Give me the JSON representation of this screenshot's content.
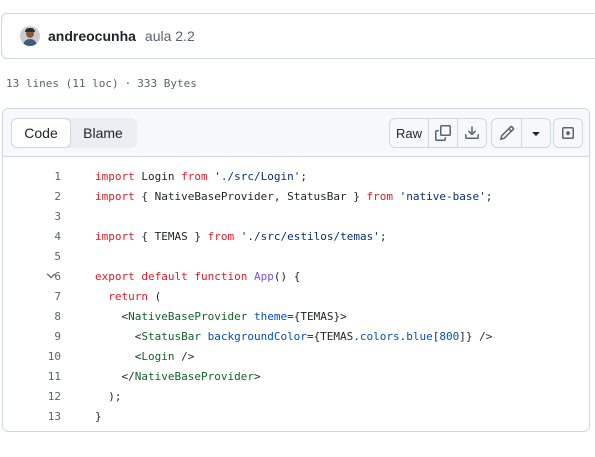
{
  "commit": {
    "author": "andreocunha",
    "message": "aula 2.2"
  },
  "file_info": {
    "lines": "13 lines (11 loc)",
    "separator": "·",
    "size": "333 Bytes"
  },
  "toolbar": {
    "code_label": "Code",
    "blame_label": "Blame",
    "raw_label": "Raw",
    "icons": [
      "copy-icon",
      "download-icon",
      "pencil-icon",
      "triangle-down-icon",
      "symbols-icon"
    ]
  },
  "colors": {
    "keyword": "#cf222e",
    "string": "#0a3069",
    "function": "#8250df",
    "tag": "#116329",
    "attribute": "#0550ae",
    "border": "#d0d7de"
  },
  "code": {
    "line_numbers": [
      "1",
      "2",
      "3",
      "4",
      "5",
      "6",
      "7",
      "8",
      "9",
      "10",
      "11",
      "12",
      "13"
    ],
    "l1": [
      "import",
      " Login ",
      "from",
      " ",
      "'./src/Login'",
      ";"
    ],
    "l2": [
      "import",
      " { NativeBaseProvider, StatusBar } ",
      "from",
      " ",
      "'native-base'",
      ";"
    ],
    "l4": [
      "import",
      " { TEMAS } ",
      "from",
      " ",
      "'./src/estilos/temas'",
      ";"
    ],
    "l6": [
      "export",
      " ",
      "default",
      " ",
      "function",
      " ",
      "App",
      "() {"
    ],
    "l7": [
      "  ",
      "return",
      " ("
    ],
    "l8": [
      "    <",
      "NativeBaseProvider",
      " ",
      "theme",
      "=",
      "{TEMAS}",
      ">"
    ],
    "l9": [
      "      <",
      "StatusBar",
      " ",
      "backgroundColor",
      "=",
      "{TEMAS.",
      "colors",
      ".",
      "blue",
      "[",
      "800",
      "]}",
      " />"
    ],
    "l10": [
      "      <",
      "Login",
      " />"
    ],
    "l11": [
      "    </",
      "NativeBaseProvider",
      ">"
    ],
    "l12": [
      "  );"
    ],
    "l13": [
      "}"
    ]
  }
}
